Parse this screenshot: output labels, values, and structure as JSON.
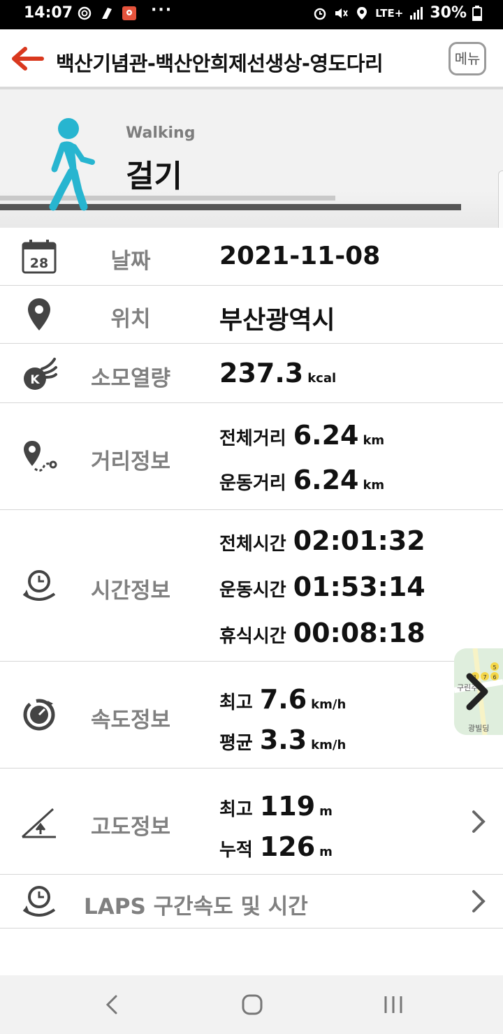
{
  "status_bar": {
    "time": "14:07",
    "dots": "···",
    "network": "LTE+",
    "battery": "30%"
  },
  "header": {
    "title": "백산기념관-백산안희제선생상-영도다리",
    "menu_label": "메뉴"
  },
  "activity": {
    "name_en": "Walking",
    "name_ko": "걸기"
  },
  "date": {
    "label": "날짜",
    "value": "2021-11-08",
    "icon_day": "28"
  },
  "location": {
    "label": "위치",
    "value": "부산광역시"
  },
  "calories": {
    "label": "소모열량",
    "value": "237.3",
    "unit": "kcal"
  },
  "distance": {
    "label": "거리정보",
    "total_label": "전체거리",
    "total": "6.24",
    "total_unit": "km",
    "exercise_label": "운동거리",
    "exercise": "6.24",
    "exercise_unit": "km"
  },
  "time": {
    "label": "시간정보",
    "total_label": "전체시간",
    "total": "02:01:32",
    "exercise_label": "운동시간",
    "exercise": "01:53:14",
    "rest_label": "휴식시간",
    "rest": "00:08:18"
  },
  "speed": {
    "label": "속도정보",
    "max_label": "최고",
    "max": "7.6",
    "max_unit": "km/h",
    "avg_label": "평균",
    "avg": "3.3",
    "avg_unit": "km/h"
  },
  "altitude": {
    "label": "고도정보",
    "max_label": "최고",
    "max": "119",
    "max_unit": "m",
    "cum_label": "누적",
    "cum": "126",
    "cum_unit": "m"
  },
  "laps": {
    "label": "LAPS 구간속도 및 시간"
  },
  "map_thumb": {
    "text": "구린주",
    "text2": "광빌딩",
    "pins": [
      "1",
      "7",
      "6",
      "5"
    ]
  },
  "colors": {
    "accent_back": "#d9381e",
    "walker": "#27b5d0",
    "label_gray": "#808080"
  }
}
